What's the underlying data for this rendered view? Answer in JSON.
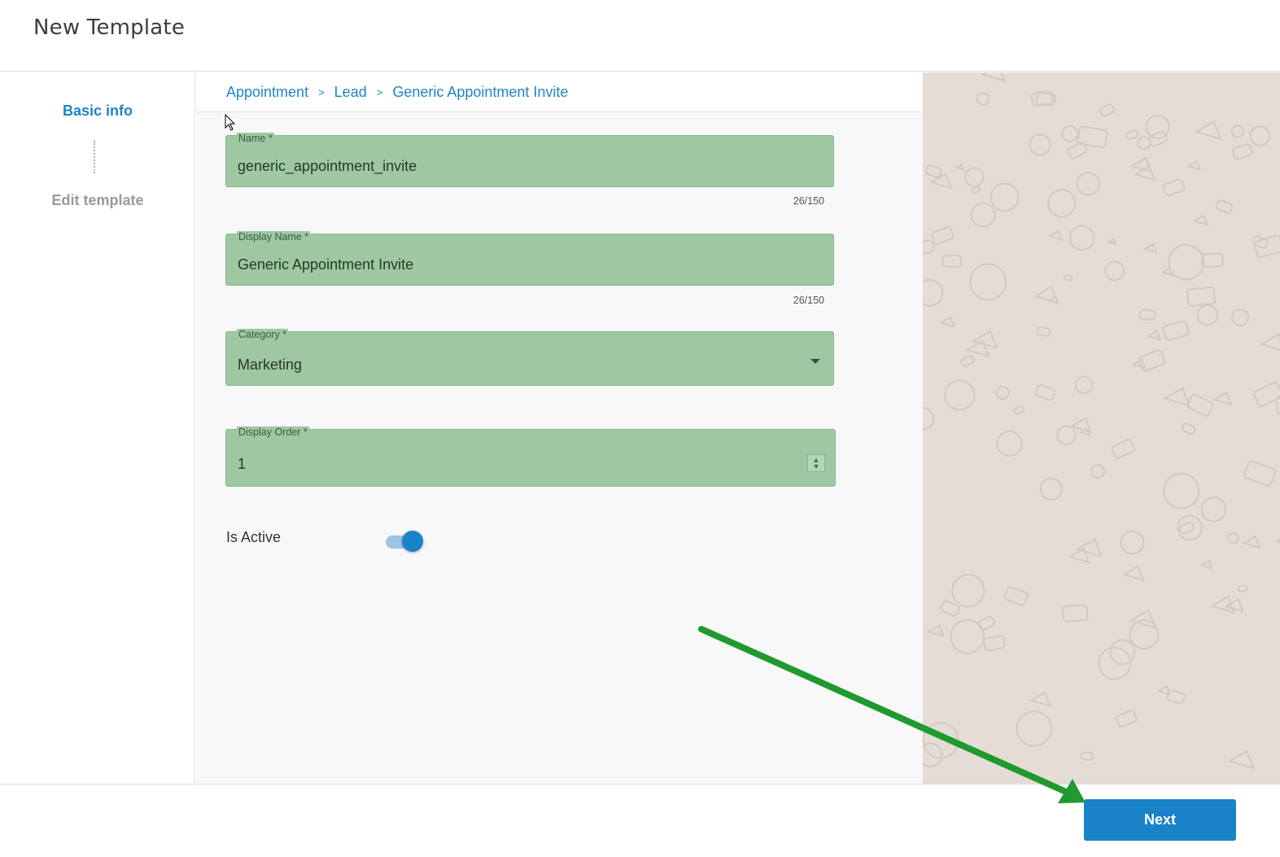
{
  "header": {
    "title": "New Template"
  },
  "sidebar": {
    "steps": [
      {
        "label": "Basic info",
        "active": true
      },
      {
        "label": "Edit template",
        "active": false
      }
    ]
  },
  "breadcrumb": {
    "items": [
      "Appointment",
      "Lead",
      "Generic Appointment Invite"
    ],
    "separator": ">"
  },
  "form": {
    "name": {
      "label": "Name *",
      "value": "generic_appointment_invite",
      "counter": "26/150"
    },
    "display_name": {
      "label": "Display Name *",
      "value": "Generic Appointment Invite",
      "counter": "26/150"
    },
    "category": {
      "label": "Category *",
      "value": "Marketing"
    },
    "display_order": {
      "label": "Display Order *",
      "value": "1"
    },
    "is_active": {
      "label": "Is Active",
      "checked": true
    }
  },
  "footer": {
    "next_label": "Next"
  },
  "colors": {
    "accent": "#1a82c7",
    "field_highlight": "#9ec8a2",
    "preview_bg": "#e5ddd5",
    "annotation_arrow": "#1e9a2e"
  }
}
